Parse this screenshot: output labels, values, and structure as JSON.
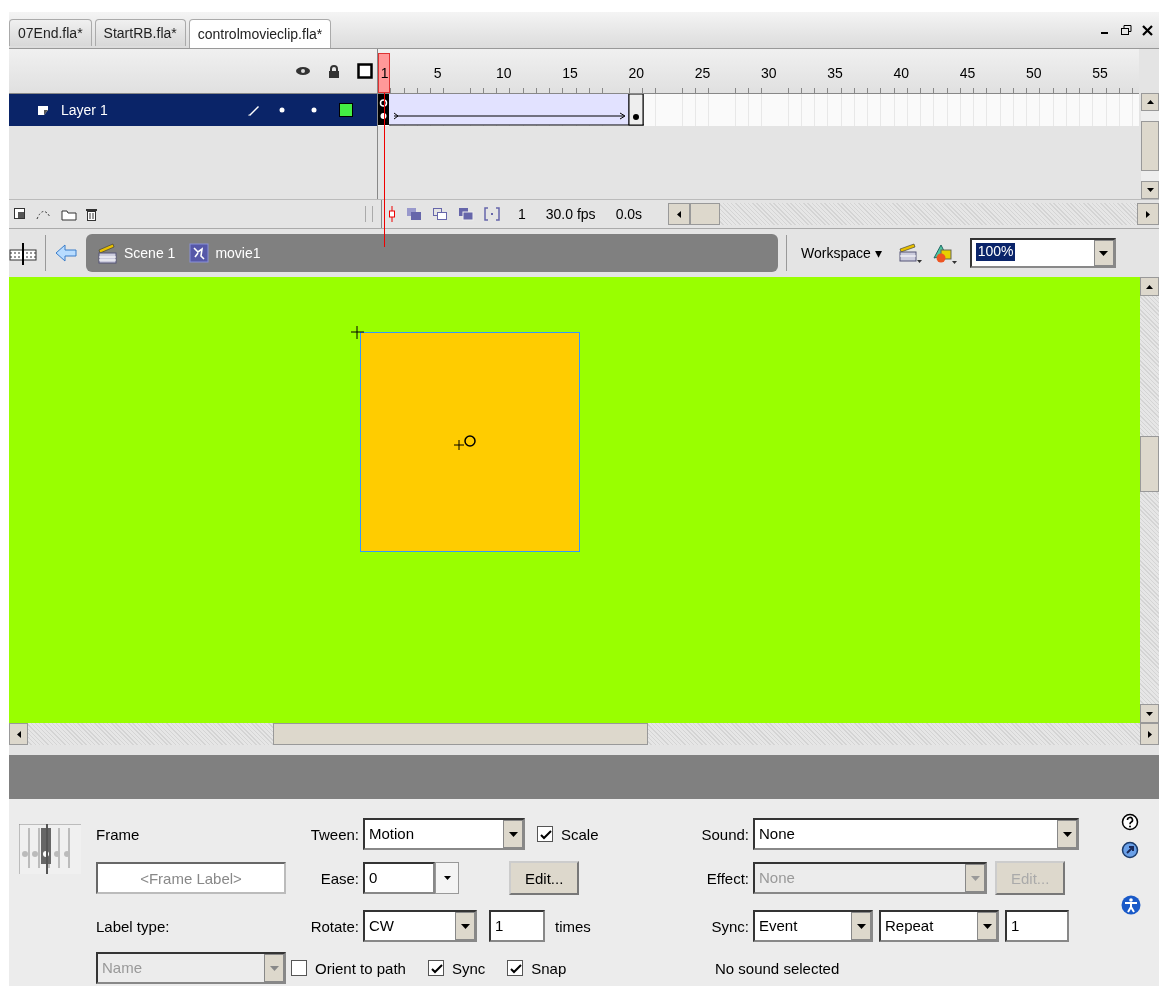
{
  "document_tabs": [
    {
      "label": "07End.fla*",
      "selected": false
    },
    {
      "label": "StartRB.fla*",
      "selected": false
    },
    {
      "label": "controlmovieclip.fla*",
      "selected": true
    }
  ],
  "timeline": {
    "ruler_labels": [
      "1",
      "5",
      "10",
      "15",
      "20",
      "25",
      "30",
      "35",
      "40",
      "45",
      "50",
      "55"
    ],
    "layers": [
      {
        "name": "Layer 1",
        "selected": true
      }
    ],
    "status": {
      "frame": "1",
      "fps": "30.0 fps",
      "time": "0.0s"
    }
  },
  "edit_bar": {
    "crumbs": [
      {
        "kind": "scene",
        "label": "Scene 1"
      },
      {
        "kind": "symbol",
        "label": "movie1"
      }
    ],
    "workspace": "Workspace ▾",
    "zoom": "100%"
  },
  "properties": {
    "title": "Frame",
    "frame_label_placeholder": "<Frame Label>",
    "label_type_label": "Label type:",
    "label_type": {
      "value": "Name",
      "disabled": true
    },
    "tween_label": "Tween:",
    "tween": "Motion",
    "ease_label": "Ease:",
    "ease": "0",
    "edit_button": "Edit...",
    "rotate_label": "Rotate:",
    "rotate": "CW",
    "times_value": "1",
    "times_label": "times",
    "checkboxes": [
      {
        "label": "Scale",
        "checked": true
      },
      {
        "label": "Orient to path",
        "checked": false
      },
      {
        "label": "Sync",
        "checked": true
      },
      {
        "label": "Snap",
        "checked": true
      }
    ],
    "sound_label": "Sound:",
    "sound": "None",
    "effect_label": "Effect:",
    "effect": {
      "value": "None",
      "disabled": true
    },
    "effect_edit": {
      "label": "Edit...",
      "disabled": true
    },
    "sync_label": "Sync:",
    "sync": "Event",
    "repeat": "Repeat",
    "repeat_count": "1",
    "sound_status": "No sound selected"
  }
}
